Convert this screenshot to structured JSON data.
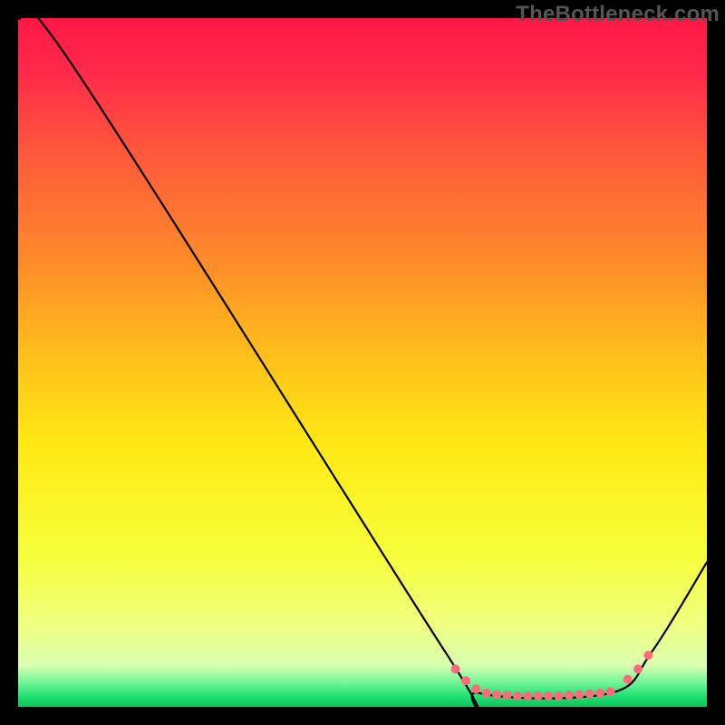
{
  "attribution": "TheBottleneck.com",
  "gradient": {
    "stops": [
      {
        "offset": 0.0,
        "color": "#ff1744"
      },
      {
        "offset": 0.08,
        "color": "#ff2a4a"
      },
      {
        "offset": 0.2,
        "color": "#ff5a3a"
      },
      {
        "offset": 0.35,
        "color": "#ff8a2a"
      },
      {
        "offset": 0.5,
        "color": "#ffc31a"
      },
      {
        "offset": 0.62,
        "color": "#ffe914"
      },
      {
        "offset": 0.78,
        "color": "#f6ff3a"
      },
      {
        "offset": 0.88,
        "color": "#f0ff80"
      },
      {
        "offset": 0.94,
        "color": "#d8ffb0"
      },
      {
        "offset": 0.965,
        "color": "#70f596"
      },
      {
        "offset": 0.985,
        "color": "#20e070"
      },
      {
        "offset": 1.0,
        "color": "#0ec35a"
      }
    ]
  },
  "chart_data": {
    "type": "line",
    "title": "",
    "xlabel": "",
    "ylabel": "",
    "x_range": [
      0,
      100
    ],
    "y_range": [
      0,
      100
    ],
    "series": [
      {
        "name": "curve",
        "x": [
          0,
          8,
          62,
          67,
          86,
          92,
          100
        ],
        "y": [
          100,
          93,
          8,
          2,
          2,
          8,
          21
        ]
      }
    ],
    "markers": {
      "name": "highlight-dots",
      "color": "#ff6b7a",
      "radius": 5,
      "points": [
        {
          "x": 63.5,
          "y": 5.5
        },
        {
          "x": 65.0,
          "y": 3.8
        },
        {
          "x": 66.5,
          "y": 2.6
        },
        {
          "x": 68.0,
          "y": 2.0
        },
        {
          "x": 69.5,
          "y": 1.8
        },
        {
          "x": 71.0,
          "y": 1.7
        },
        {
          "x": 72.5,
          "y": 1.6
        },
        {
          "x": 74.0,
          "y": 1.6
        },
        {
          "x": 75.5,
          "y": 1.6
        },
        {
          "x": 77.0,
          "y": 1.6
        },
        {
          "x": 78.5,
          "y": 1.6
        },
        {
          "x": 80.0,
          "y": 1.7
        },
        {
          "x": 81.5,
          "y": 1.8
        },
        {
          "x": 83.0,
          "y": 1.9
        },
        {
          "x": 84.5,
          "y": 2.0
        },
        {
          "x": 86.0,
          "y": 2.2
        },
        {
          "x": 88.5,
          "y": 4.0
        },
        {
          "x": 90.0,
          "y": 5.5
        },
        {
          "x": 91.5,
          "y": 7.5
        }
      ]
    }
  }
}
